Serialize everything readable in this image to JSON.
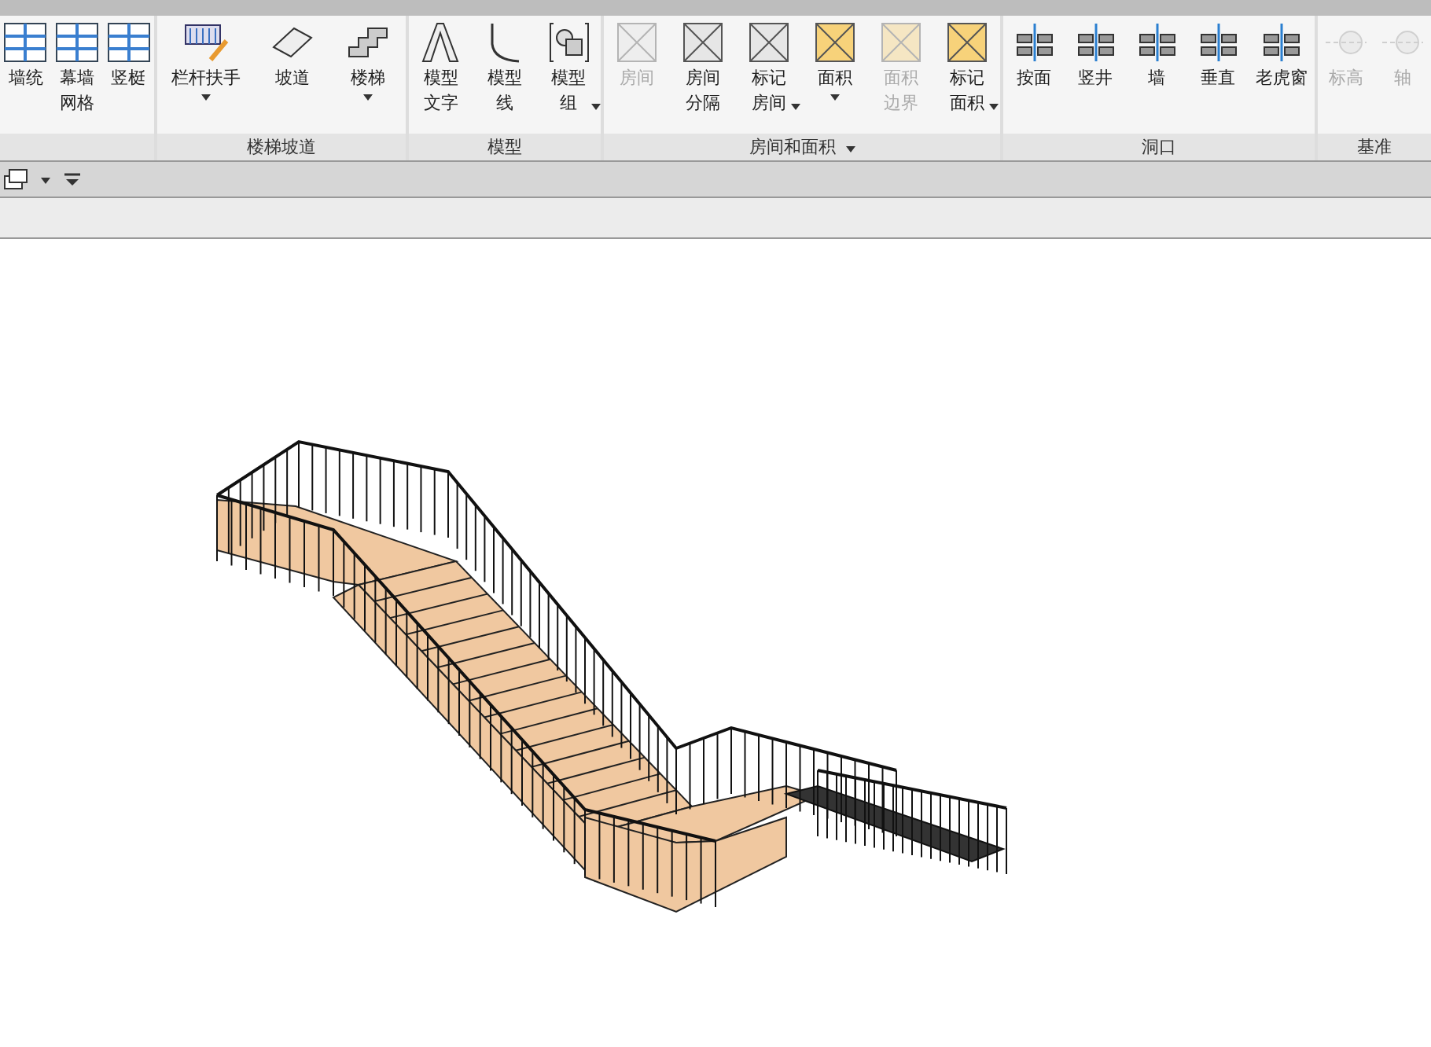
{
  "panels": [
    {
      "title_dropdown": false,
      "buttons": [
        {
          "label": "墙统",
          "disabled": false,
          "dropdown": false
        },
        {
          "label": "幕墙网格",
          "disabled": false,
          "dropdown": false
        },
        {
          "label": "竖梃",
          "disabled": false,
          "dropdown": false
        }
      ]
    },
    {
      "title": "楼梯坡道",
      "title_dropdown": false,
      "buttons": [
        {
          "label": "栏杆扶手",
          "disabled": false,
          "dropdown": true
        },
        {
          "label": "坡道",
          "disabled": false,
          "dropdown": false
        },
        {
          "label": "楼梯",
          "disabled": false,
          "dropdown": true
        }
      ]
    },
    {
      "title": "模型",
      "title_dropdown": false,
      "buttons": [
        {
          "label": "模型文字",
          "disabled": false,
          "dropdown": false
        },
        {
          "label": "模型线",
          "disabled": false,
          "dropdown": false
        },
        {
          "label": "模型组",
          "disabled": false,
          "dropdown": true
        }
      ]
    },
    {
      "title": "房间和面积",
      "title_dropdown": true,
      "buttons": [
        {
          "label": "房间",
          "disabled": true,
          "dropdown": false
        },
        {
          "label": "房间分隔",
          "disabled": false,
          "dropdown": false
        },
        {
          "label": "标记房间",
          "disabled": false,
          "dropdown": true
        },
        {
          "label": "面积",
          "disabled": false,
          "dropdown": true
        },
        {
          "label": "面积边界",
          "disabled": true,
          "dropdown": false
        },
        {
          "label": "标记面积",
          "disabled": false,
          "dropdown": true
        }
      ]
    },
    {
      "title": "洞口",
      "title_dropdown": false,
      "buttons": [
        {
          "label": "按面",
          "disabled": false,
          "dropdown": false
        },
        {
          "label": "竖井",
          "disabled": false,
          "dropdown": false
        },
        {
          "label": "墙",
          "disabled": false,
          "dropdown": false
        },
        {
          "label": "垂直",
          "disabled": false,
          "dropdown": false
        },
        {
          "label": "老虎窗",
          "disabled": false,
          "dropdown": false
        }
      ]
    },
    {
      "title": "基准",
      "title_dropdown": false,
      "buttons": [
        {
          "label": "标高",
          "disabled": true,
          "dropdown": false
        },
        {
          "label": "轴",
          "disabled": true,
          "dropdown": false
        }
      ]
    }
  ]
}
